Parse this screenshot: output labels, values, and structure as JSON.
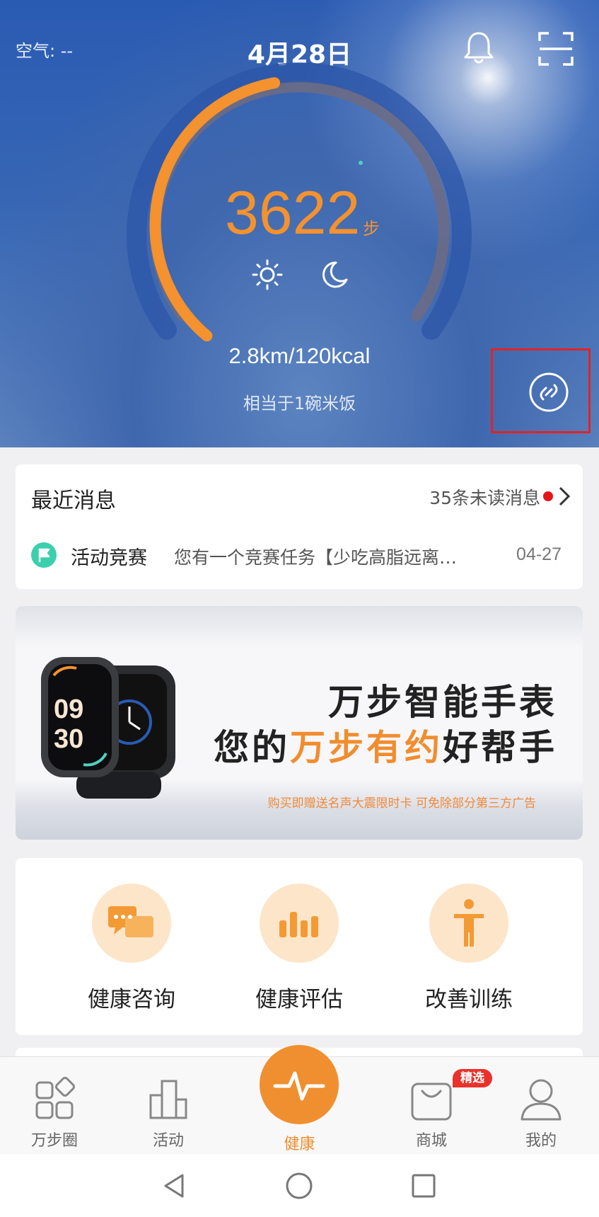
{
  "header": {
    "air_label": "空气: --",
    "date": "4月28日",
    "icons": [
      "bell-icon",
      "scan-icon"
    ]
  },
  "steps": {
    "count": "3622",
    "unit": "步",
    "progress_fraction": 0.5,
    "distance_energy": "2.8km/120kcal",
    "equivalent": "相当于1碗米饭",
    "mode_icons": [
      "sun-icon",
      "moon-icon"
    ]
  },
  "messages": {
    "title": "最近消息",
    "unread": "35条未读消息",
    "item": {
      "category": "活动竞赛",
      "text": "您有一个竞赛任务【少吃高脂远离…",
      "date": "04-27"
    }
  },
  "banner": {
    "line1": "万步智能手表",
    "line2_prefix": "您的",
    "line2_highlight": "万步有约",
    "line2_suffix": "好帮手",
    "note": "购买即赠送名声大震限时卡 可免除部分第三方广告",
    "watch_time_h": "09",
    "watch_time_m": "30"
  },
  "services": [
    {
      "label": "健康咨询",
      "icon": "chat-icon"
    },
    {
      "label": "健康评估",
      "icon": "bar-chart-icon"
    },
    {
      "label": "改善训练",
      "icon": "person-exercise-icon"
    }
  ],
  "nav": {
    "items": [
      {
        "label": "万步圈",
        "icon": "circle-apps-icon"
      },
      {
        "label": "活动",
        "icon": "buildings-icon"
      },
      {
        "label": "健康",
        "icon": "pulse-icon"
      },
      {
        "label": "商城",
        "icon": "shopping-bag-icon"
      },
      {
        "label": "我的",
        "icon": "user-icon"
      }
    ],
    "badge": "精选"
  },
  "colors": {
    "accent": "#f08f2f",
    "hero_blue": "#2a5bb3",
    "highlight_box": "#e02424"
  }
}
